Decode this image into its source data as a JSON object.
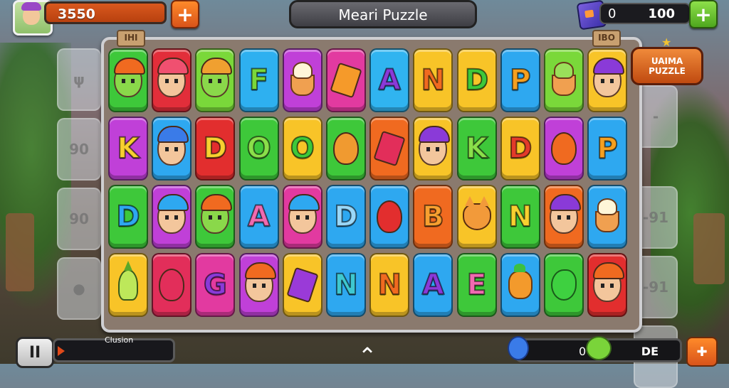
{
  "hud": {
    "score": "3550",
    "title": "Meari Puzzle",
    "gem_left": "0",
    "gem_total": "100",
    "plus_glyph": "+"
  },
  "side_badge": {
    "line1": "UAIMA",
    "line2": "PUZZLE"
  },
  "bottom": {
    "progress_label": "Clusion",
    "left_value": "0",
    "right_value": "DE",
    "up_glyph": "⌃"
  },
  "frame_tabs": {
    "left": "IHI",
    "right": "IBO"
  },
  "ghost_left": [
    "ψ",
    "90",
    "90",
    "●"
  ],
  "ghost_right": [
    "-",
    "-91",
    "-91",
    "✕"
  ],
  "tiles": [
    [
      {
        "kind": "face",
        "color": "#3ec83a",
        "hair": "#f06a20",
        "face": "green-face"
      },
      {
        "kind": "face",
        "color": "#e22e3a",
        "hair": "#f05070"
      },
      {
        "kind": "face",
        "color": "#7ad83a",
        "hair": "#f0a030",
        "face": "green-face"
      },
      {
        "kind": "letter",
        "text": "F",
        "color": "#2eb0f0",
        "glyph": "#7ad83a"
      },
      {
        "kind": "cup",
        "color": "#c040d8"
      },
      {
        "kind": "diamond",
        "color": "#e23aa0",
        "fill": "#f59a2a"
      },
      {
        "kind": "letter",
        "text": "A",
        "color": "#30b4f0",
        "glyph": "#8a3ad8"
      },
      {
        "kind": "letter",
        "text": "N",
        "color": "#f8c428",
        "glyph": "#f06a20"
      },
      {
        "kind": "letter",
        "text": "D",
        "color": "#f8c428",
        "glyph": "#3ec83a"
      },
      {
        "kind": "letter",
        "text": "P",
        "color": "#2ea8f0",
        "glyph": "#f5a020"
      },
      {
        "kind": "cup",
        "color": "#7ad83a",
        "variant": "green"
      },
      {
        "kind": "face",
        "color": "#f8c428",
        "hair": "#8a3ad8"
      }
    ],
    [
      {
        "kind": "letter",
        "text": "K",
        "color": "#c040d8",
        "glyph": "#f8d030"
      },
      {
        "kind": "face",
        "color": "#2ea8f0",
        "hair": "#3a7be8"
      },
      {
        "kind": "letter",
        "text": "D",
        "color": "#e22e2e",
        "glyph": "#f8d030"
      },
      {
        "kind": "letter",
        "text": "O",
        "color": "#3ec83a",
        "glyph": "#8ae04a"
      },
      {
        "kind": "letter",
        "text": "O",
        "color": "#f8c428",
        "glyph": "#3ec83a"
      },
      {
        "kind": "egg",
        "color": "#3ec83a",
        "fill": "#f09a30"
      },
      {
        "kind": "diamond",
        "color": "#f06a20",
        "fill": "#e22e5a"
      },
      {
        "kind": "face",
        "color": "#f8c428",
        "hair": "#8a3ad8"
      },
      {
        "kind": "letter",
        "text": "K",
        "color": "#3ec83a",
        "glyph": "#8ae04a"
      },
      {
        "kind": "letter",
        "text": "D",
        "color": "#f8c428",
        "glyph": "#e23a2a"
      },
      {
        "kind": "egg",
        "color": "#c040d8",
        "fill": "#f06a20"
      },
      {
        "kind": "letter",
        "text": "P",
        "color": "#2ea8f0",
        "glyph": "#f5a020"
      }
    ],
    [
      {
        "kind": "letter",
        "text": "D",
        "color": "#3ec83a",
        "glyph": "#2ea8f0"
      },
      {
        "kind": "face",
        "color": "#c040d8",
        "hair": "#2ea8f0"
      },
      {
        "kind": "face",
        "color": "#3ec83a",
        "hair": "#f06a20",
        "face": "green-face"
      },
      {
        "kind": "letter",
        "text": "A",
        "color": "#2ea8f0",
        "glyph": "#f06ab0"
      },
      {
        "kind": "face",
        "color": "#e23aa0",
        "hair": "#2ea8f0"
      },
      {
        "kind": "letter",
        "text": "D",
        "color": "#2ea8f0",
        "glyph": "#9ad8f8"
      },
      {
        "kind": "egg",
        "color": "#2ea8f0",
        "fill": "#e22e2e"
      },
      {
        "kind": "letter",
        "text": "B",
        "color": "#f06a20",
        "glyph": "#f8a030"
      },
      {
        "kind": "cat",
        "color": "#f8c428"
      },
      {
        "kind": "letter",
        "text": "N",
        "color": "#3ec83a",
        "glyph": "#f8d030"
      },
      {
        "kind": "face",
        "color": "#f06a20",
        "hair": "#8a3ad8"
      },
      {
        "kind": "cup",
        "color": "#2ea8f0"
      }
    ],
    [
      {
        "kind": "gnome",
        "color": "#f8c428"
      },
      {
        "kind": "egg",
        "color": "#e22e5a",
        "fill": "#e22e5a"
      },
      {
        "kind": "letter",
        "text": "G",
        "color": "#e23aa0",
        "glyph": "#8a3ad8"
      },
      {
        "kind": "face",
        "color": "#c040d8",
        "hair": "#f06a20"
      },
      {
        "kind": "diamond",
        "color": "#f8c428",
        "fill": "#9a3ad8"
      },
      {
        "kind": "letter",
        "text": "N",
        "color": "#2ea8f0",
        "glyph": "#3ec8d0"
      },
      {
        "kind": "letter",
        "text": "N",
        "color": "#f8c428",
        "glyph": "#f06a20"
      },
      {
        "kind": "letter",
        "text": "A",
        "color": "#2ea8f0",
        "glyph": "#8a3ad8"
      },
      {
        "kind": "letter",
        "text": "E",
        "color": "#3ec83a",
        "glyph": "#f06ab0"
      },
      {
        "kind": "mascot",
        "color": "#2ea8f0"
      },
      {
        "kind": "fruit",
        "color": "#3ec83a"
      },
      {
        "kind": "face",
        "color": "#e22e2e",
        "hair": "#f06a20"
      }
    ]
  ]
}
